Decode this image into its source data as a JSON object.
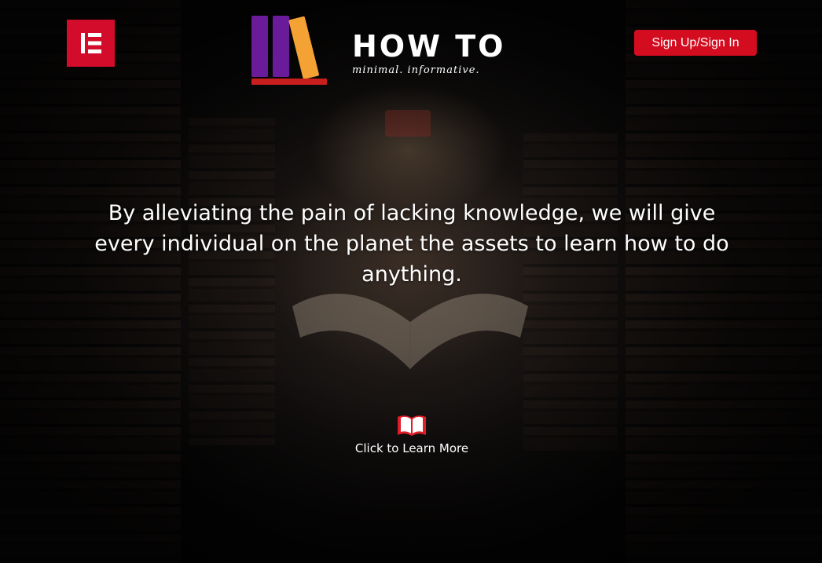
{
  "header": {
    "elementor_icon": "elementor-icon",
    "brand": {
      "title": "HOW TO",
      "tagline": "minimal. informative.",
      "logo_icon": "books-icon",
      "colors": {
        "purple": "#6a1b9a",
        "orange": "#f4a233",
        "red": "#c81e1e"
      }
    },
    "signup_label": "Sign Up/Sign In"
  },
  "hero": {
    "text": "By alleviating the pain of lacking knowledge, we will give every individual on the planet the assets to learn how to do anything."
  },
  "cta": {
    "icon": "open-book-icon",
    "label": "Click to Learn More"
  },
  "colors": {
    "accent": "#d30c1f",
    "text": "#ffffff"
  }
}
